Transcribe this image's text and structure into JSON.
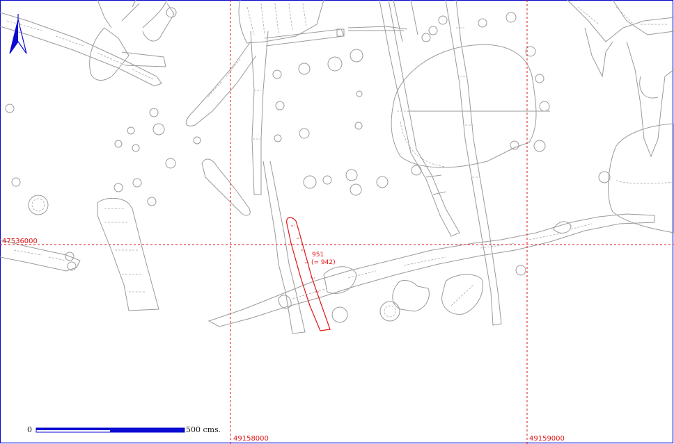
{
  "grid_labels": {
    "northing": "47536000",
    "easting_left": "49158000",
    "easting_right": "49159000"
  },
  "feature_label": {
    "id": "951",
    "equiv": "(= 942)"
  },
  "scale_bar": {
    "start": "0",
    "end": "500 cms."
  },
  "north_arrow": {
    "icon": "north-arrow-icon",
    "color": "#0a0ad2"
  },
  "colors": {
    "grid": "#e01414",
    "features": "#9a9a9a",
    "frame": "#0a0ad2"
  }
}
